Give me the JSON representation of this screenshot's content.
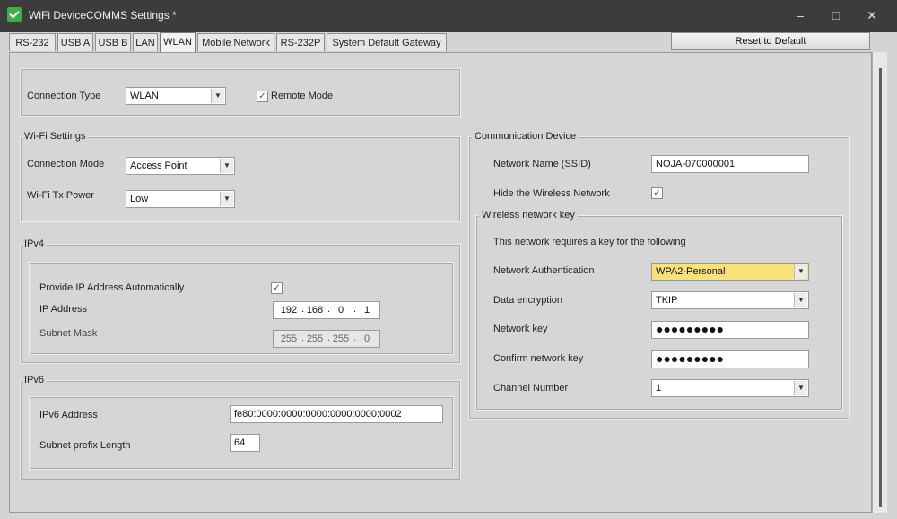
{
  "window": {
    "title": "WiFi DeviceCOMMS Settings *"
  },
  "titlebar_buttons": {
    "minimize": "–",
    "maximize": "□",
    "close": "✕"
  },
  "tabs": [
    {
      "label": "RS-232"
    },
    {
      "label": "USB A"
    },
    {
      "label": "USB B"
    },
    {
      "label": "LAN"
    },
    {
      "label": "WLAN"
    },
    {
      "label": "Mobile Network"
    },
    {
      "label": "RS-232P"
    },
    {
      "label": "System Default Gateway"
    }
  ],
  "active_tab": "WLAN",
  "reset_button": "Reset to Default",
  "connection": {
    "label": "Connection Type",
    "value": "WLAN",
    "remote_mode_label": "Remote Mode",
    "remote_mode_checked": true
  },
  "wifi_settings": {
    "title": "Wi-Fi Settings",
    "mode_label": "Connection Mode",
    "mode_value": "Access Point",
    "tx_label": "Wi-Fi Tx Power",
    "tx_value": "Low"
  },
  "ipv4": {
    "title": "IPv4",
    "auto_label": "Provide IP Address Automatically",
    "auto_checked": true,
    "ip_label": "IP Address",
    "ip": [
      "192",
      "168",
      "0",
      "1"
    ],
    "mask_label": "Subnet Mask",
    "mask": [
      "255",
      "255",
      "255",
      "0"
    ]
  },
  "ipv6": {
    "title": "IPv6",
    "addr_label": "IPv6 Address",
    "addr_value": "fe80:0000:0000:0000:0000:0000:0002",
    "prefix_label": "Subnet prefix Length",
    "prefix_value": "64"
  },
  "comm_device": {
    "title": "Communication Device",
    "ssid_label": "Network Name (SSID)",
    "ssid_value": "NOJA-070000001",
    "hide_label": "Hide the Wireless Network",
    "hide_checked": true,
    "key_group": {
      "title": "Wireless network key",
      "note": "This network requires a key for the following",
      "auth_label": "Network Authentication",
      "auth_value": "WPA2-Personal",
      "enc_label": "Data encryption",
      "enc_value": "TKIP",
      "key_label": "Network key",
      "key_value": "●●●●●●●●●",
      "confirm_label": "Confirm network key",
      "confirm_value": "●●●●●●●●●",
      "channel_label": "Channel Number",
      "channel_value": "1"
    }
  },
  "icons": {
    "app": "app-check-icon",
    "dropdown": "chevron-down-icon",
    "checkmark": "checkmark-icon"
  },
  "check_glyph": "✓",
  "arrow_glyph": "▼"
}
